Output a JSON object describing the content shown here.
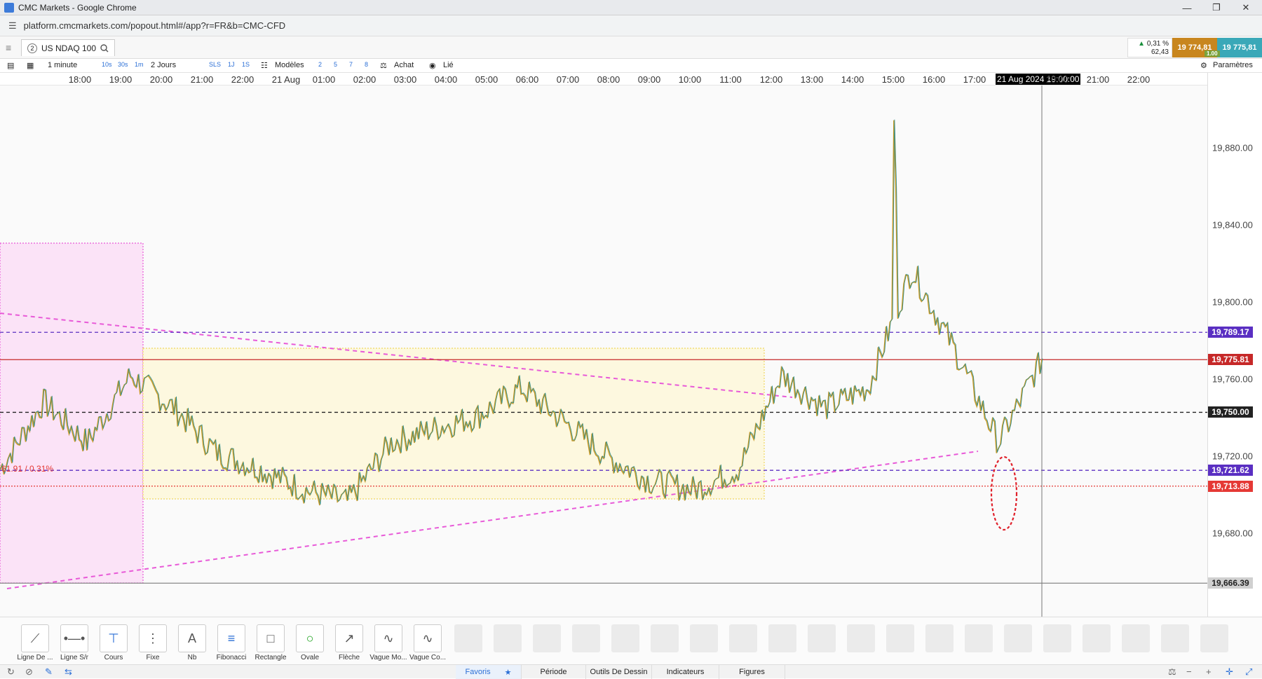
{
  "window": {
    "title": "CMC Markets - Google Chrome"
  },
  "browser": {
    "url": "platform.cmcmarkets.com/popout.html#/app?r=FR&b=CMC-CFD"
  },
  "instrument": {
    "tab_number": "2",
    "name": "US NDAQ 100"
  },
  "quote": {
    "change_pct": "0,31 %",
    "change_pts": "62,43",
    "sell": "19 774,81",
    "buy": "19 775,81",
    "spread": "1.00"
  },
  "toolbar": {
    "interval": "1 minute",
    "quick_intervals": [
      "10s",
      "30s",
      "1m"
    ],
    "range": "2 Jours",
    "sls": "SLS",
    "days": [
      "1J",
      "1S"
    ],
    "models_label": "Modèles",
    "counts": [
      "2",
      "5",
      "7",
      "8"
    ],
    "buy_label": "Achat",
    "linked_label": "Lié",
    "settings_label": "Paramètres"
  },
  "time_axis": {
    "labels": [
      "18:00",
      "19:00",
      "20:00",
      "21:00",
      "22:00",
      "21 Aug",
      "01:00",
      "02:00",
      "03:00",
      "04:00",
      "05:00",
      "06:00",
      "07:00",
      "08:00",
      "09:00",
      "10:00",
      "11:00",
      "12:00",
      "13:00",
      "14:00",
      "15:00",
      "16:00",
      "17:00",
      "20:00",
      "21:00",
      "22:00"
    ],
    "cursor_label": "21 Aug 2024 19:00:00"
  },
  "price_axis": {
    "labels": [
      "19,880.00",
      "19,840.00",
      "19,800.00",
      "19,760.00",
      "19,720.00",
      "19,680.00"
    ],
    "tags": [
      {
        "value": "19,789.17",
        "color": "#5a2fc2"
      },
      {
        "value": "19,775.81",
        "color": "#c62828"
      },
      {
        "value": "19,750.00",
        "color": "#222222"
      },
      {
        "value": "19,721.62",
        "color": "#5a2fc2"
      },
      {
        "value": "19,713.88",
        "color": "#e53935"
      },
      {
        "value": "19,666.39",
        "color": "#d0d0d0"
      }
    ]
  },
  "fib_label": "61.91 / 0.31%",
  "chart_data": {
    "type": "line",
    "title": "US NDAQ 100",
    "interval": "1 minute",
    "x": [
      "18:00",
      "19:00",
      "20:00",
      "21:00",
      "22:00",
      "21 Aug",
      "01:00",
      "02:00",
      "03:00",
      "04:00",
      "05:00",
      "06:00",
      "07:00",
      "08:00",
      "09:00",
      "10:00",
      "11:00",
      "12:00",
      "13:00",
      "14:00",
      "15:00",
      "16:00",
      "17:00",
      "18:00",
      "19:00"
    ],
    "series": [
      {
        "values": [
          19722,
          19755,
          19735,
          19768,
          19752,
          19730,
          19722,
          19712,
          19706,
          19735,
          19742,
          19748,
          19762,
          19745,
          19728,
          19716,
          19712,
          19722,
          19768,
          19752,
          19762,
          19820,
          19780,
          19735,
          19776
        ]
      }
    ],
    "ylim": [
      19650,
      19910
    ],
    "levels": [
      19789.17,
      19775.81,
      19750.0,
      19721.62,
      19713.88,
      19666.39
    ],
    "grid": false
  },
  "drawing_tools": [
    {
      "label": "Ligne De ...",
      "icon": "line-icon"
    },
    {
      "label": "Ligne S/r",
      "icon": "sr-line-icon"
    },
    {
      "label": "Cours",
      "icon": "price-icon"
    },
    {
      "label": "Fixe",
      "icon": "fixed-icon"
    },
    {
      "label": "Nb",
      "icon": "text-icon"
    },
    {
      "label": "Fibonacci",
      "icon": "fibonacci-icon"
    },
    {
      "label": "Rectangle",
      "icon": "rectangle-icon"
    },
    {
      "label": "Ovale",
      "icon": "oval-icon"
    },
    {
      "label": "Flèche",
      "icon": "arrow-icon"
    },
    {
      "label": "Vague Mo...",
      "icon": "wave-icon"
    },
    {
      "label": "Vague Co...",
      "icon": "wave-co-icon"
    }
  ],
  "bottom_tabs": [
    "Favoris",
    "Période",
    "Outils De Dessin",
    "Indicateurs",
    "Figures"
  ]
}
